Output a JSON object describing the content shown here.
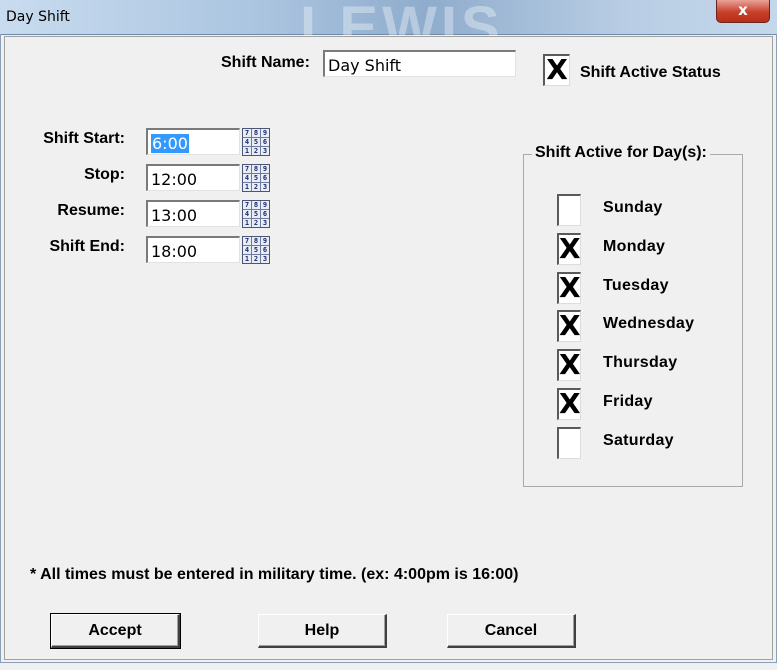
{
  "window": {
    "title": "Day Shift",
    "close_icon": "close-icon",
    "close_glyph": "x"
  },
  "form": {
    "shift_name_label": "Shift Name:",
    "shift_name_value": "Day Shift",
    "active_status_label": "Shift Active Status",
    "active_status_checked": true,
    "check_mark": "X",
    "times": [
      {
        "label": "Shift Start:",
        "value": "6:00",
        "selected": true
      },
      {
        "label": "Stop:",
        "value": "12:00",
        "selected": false
      },
      {
        "label": "Resume:",
        "value": "13:00",
        "selected": false
      },
      {
        "label": "Shift End:",
        "value": "18:00",
        "selected": false
      }
    ],
    "keypad_icon": "keypad-icon",
    "keypad_keys": [
      "7",
      "8",
      "9",
      "4",
      "5",
      "6",
      "1",
      "2",
      "3"
    ]
  },
  "days_group": {
    "title": "Shift Active for Day(s):",
    "days": [
      {
        "label": "Sunday",
        "checked": false
      },
      {
        "label": "Monday",
        "checked": true
      },
      {
        "label": "Tuesday",
        "checked": true
      },
      {
        "label": "Wednesday",
        "checked": true
      },
      {
        "label": "Thursday",
        "checked": true
      },
      {
        "label": "Friday",
        "checked": true
      },
      {
        "label": "Saturday",
        "checked": false
      }
    ]
  },
  "note": "*  All times must be entered in military time. (ex: 4:00pm is 16:00)",
  "buttons": {
    "accept": "Accept",
    "help": "Help",
    "cancel": "Cancel"
  }
}
